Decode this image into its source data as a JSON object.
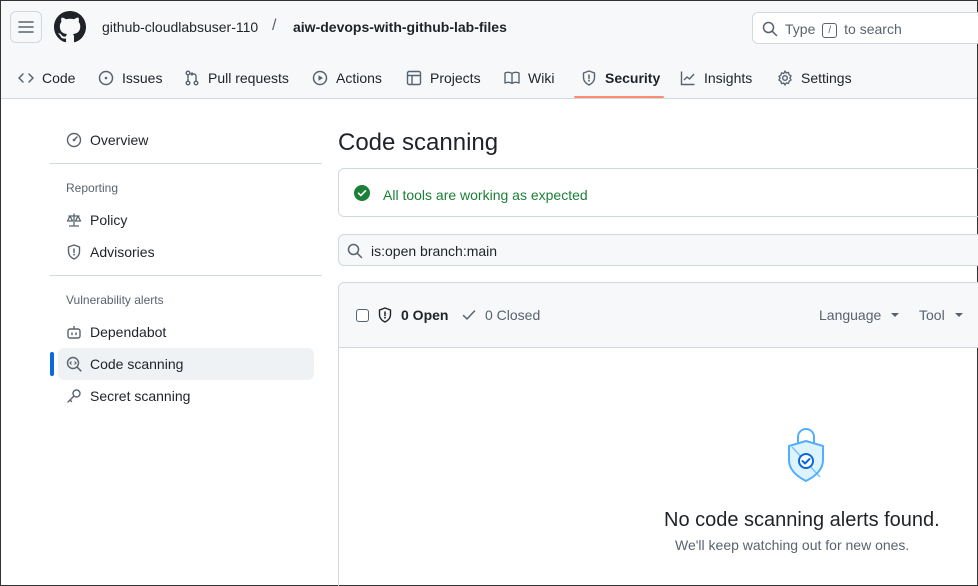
{
  "header": {
    "owner": "github-cloudlabsuser-110",
    "separator": "/",
    "repo": "aiw-devops-with-github-lab-files",
    "search_prefix": "Type",
    "search_key": "/",
    "search_suffix": "to search"
  },
  "tabs": [
    {
      "label": "Code",
      "icon": "code-icon"
    },
    {
      "label": "Issues",
      "icon": "issue-icon"
    },
    {
      "label": "Pull requests",
      "icon": "pull-request-icon"
    },
    {
      "label": "Actions",
      "icon": "play-icon"
    },
    {
      "label": "Projects",
      "icon": "table-icon"
    },
    {
      "label": "Wiki",
      "icon": "book-icon"
    },
    {
      "label": "Security",
      "icon": "shield-icon",
      "active": true
    },
    {
      "label": "Insights",
      "icon": "graph-icon"
    },
    {
      "label": "Settings",
      "icon": "gear-icon"
    }
  ],
  "sidebar": {
    "overview": "Overview",
    "reporting_heading": "Reporting",
    "policy": "Policy",
    "advisories": "Advisories",
    "vuln_heading": "Vulnerability alerts",
    "dependabot": "Dependabot",
    "code_scanning": "Code scanning",
    "secret_scanning": "Secret scanning"
  },
  "main": {
    "title": "Code scanning",
    "tools_status": "All tools are working as expected",
    "filter_value": "is:open branch:main",
    "open_label": "0 Open",
    "closed_label": "0 Closed",
    "language_label": "Language",
    "tool_label": "Tool",
    "empty_title": "No code scanning alerts found.",
    "empty_subtitle": "We'll keep watching out for new ones."
  },
  "colors": {
    "accent": "#0969da",
    "tab_underline": "#fd8c73",
    "success": "#1a7f37",
    "empty_icon": "#54aeff"
  }
}
